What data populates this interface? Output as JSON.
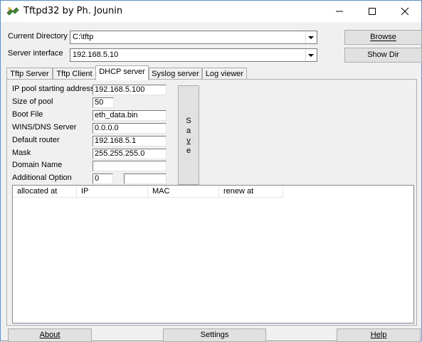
{
  "window": {
    "title": "Tftpd32 by Ph. Jounin"
  },
  "top": {
    "current_directory_label": "Current Directory",
    "current_directory_value": "C:\\tftp",
    "server_interface_label": "Server interface",
    "server_interface_value": "192.168.5.10",
    "browse_label": "Browse",
    "show_dir_label": "Show Dir"
  },
  "tabs": [
    {
      "label": "Tftp Server"
    },
    {
      "label": "Tftp Client"
    },
    {
      "label": "DHCP server"
    },
    {
      "label": "Syslog server"
    },
    {
      "label": "Log viewer"
    }
  ],
  "dhcp": {
    "ip_pool_label": "IP pool starting address",
    "ip_pool_value": "192.168.5.100",
    "pool_size_label": "Size of pool",
    "pool_size_value": "50",
    "boot_file_label": "Boot File",
    "boot_file_value": "eth_data.bin",
    "wins_dns_label": "WINS/DNS Server",
    "wins_dns_value": "0.0.0.0",
    "default_router_label": "Default router",
    "default_router_value": "192.168.5.1",
    "mask_label": "Mask",
    "mask_value": "255.255.255.0",
    "domain_name_label": "Domain Name",
    "domain_name_value": "",
    "additional_option_label": "Additional Option",
    "additional_option_value": "0",
    "additional_option_data": "",
    "save_letters": [
      "S",
      "a",
      "v",
      "e"
    ]
  },
  "leases": {
    "columns": [
      {
        "label": "allocated at"
      },
      {
        "label": "IP"
      },
      {
        "label": "MAC"
      },
      {
        "label": "renew at"
      }
    ],
    "rows": []
  },
  "bottom": {
    "about_label": "About",
    "settings_label": "Settings",
    "help_label": "Help"
  }
}
